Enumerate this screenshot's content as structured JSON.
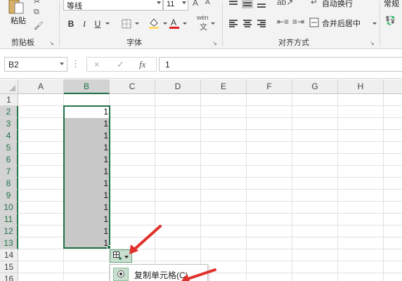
{
  "ribbon": {
    "clipboard": {
      "paste_label": "粘贴",
      "group_label": "剪贴板"
    },
    "font": {
      "font_name": "等线",
      "font_size": "11",
      "bold": "B",
      "italic": "I",
      "underline": "U",
      "phonetic": "wén",
      "group_label": "字体"
    },
    "alignment": {
      "wrap_text": "自动换行",
      "merge_center": "合并后居中",
      "group_label": "对齐方式"
    },
    "number": {
      "format": "常规"
    }
  },
  "formula_bar": {
    "name_box": "B2",
    "cancel": "×",
    "enter": "✓",
    "fx": "fx",
    "value": "1"
  },
  "grid": {
    "columns": [
      "A",
      "B",
      "C",
      "D",
      "E",
      "F",
      "G",
      "H"
    ],
    "rows": [
      "1",
      "2",
      "3",
      "4",
      "5",
      "6",
      "7",
      "8",
      "9",
      "10",
      "11",
      "12",
      "13",
      "14",
      "15",
      "16"
    ],
    "selected_column": "B",
    "cells_b2_b13": [
      "1",
      "1",
      "1",
      "1",
      "1",
      "1",
      "1",
      "1",
      "1",
      "1",
      "1",
      "1"
    ]
  },
  "autofill_menu": {
    "option": "复制单元格(C)"
  },
  "colors": {
    "excel_green": "#217346",
    "highlight_yellow": "#ffd966",
    "font_red": "#e02020",
    "annotation_red": "#e0322b"
  }
}
